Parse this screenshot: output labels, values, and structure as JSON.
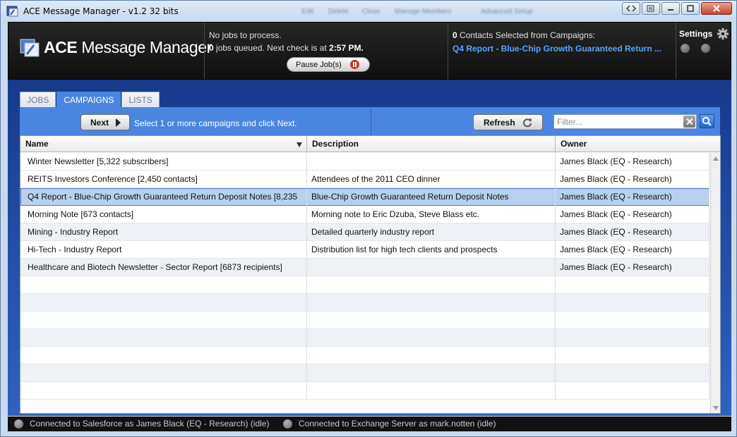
{
  "window": {
    "title": "ACE Message Manager - v1.2 32 bits",
    "obscured_menu": [
      "Edit",
      "Delete",
      "Close",
      "Manage Members",
      "Advanced Setup"
    ]
  },
  "header": {
    "logo_bold": "ACE",
    "logo_rest": " Message Manager",
    "status_line1": "No jobs to process.",
    "jobs_queued_count": "0",
    "status_line2": " jobs queued.  Next check is at ",
    "next_check_time": "2:57 PM.",
    "pause_label": "Pause Job(s)",
    "contacts_count": "0",
    "contacts_text": " Contacts Selected from Campaigns:",
    "selected_campaign_link": "Q4 Report - Blue-Chip Growth Guaranteed Return ...",
    "settings_label": "Settings"
  },
  "tabs": [
    {
      "label": "JOBS",
      "active": false
    },
    {
      "label": "CAMPAIGNS",
      "active": true
    },
    {
      "label": "LISTS",
      "active": false
    }
  ],
  "toolbar": {
    "next_label": "Next",
    "hint": "Select 1 or more campaigns and click Next.",
    "refresh_label": "Refresh",
    "filter_placeholder": "Filter..."
  },
  "grid": {
    "columns": [
      "Name",
      "Description",
      "Owner"
    ],
    "rows": [
      {
        "name": "Winter Newsletter [5,322 subscribers]",
        "description": "",
        "owner": "James Black (EQ - Research)"
      },
      {
        "name": "REITS Investors Conference [2,450 contacts]",
        "description": "Attendees of the 2011 CEO dinner",
        "owner": "James Black (EQ - Research)"
      },
      {
        "name": "Q4 Report - Blue-Chip Growth Guaranteed Return Deposit Notes  [8,235",
        "description": "Blue-Chip Growth Guaranteed Return Deposit Notes",
        "owner": "James Black (EQ - Research)",
        "selected": true
      },
      {
        "name": "Morning Note [673 contacts]",
        "description": "Morning note to Eric Dzuba, Steve Blass etc.",
        "owner": "James Black (EQ - Research)"
      },
      {
        "name": "Mining - Industry Report",
        "description": "Detailed quarterly industry report",
        "owner": "James Black (EQ - Research)"
      },
      {
        "name": "Hi-Tech - Industry Report",
        "description": "Distribution list for high tech clients and prospects",
        "owner": "James Black (EQ - Research)"
      },
      {
        "name": "Healthcare and Biotech Newsletter - Sector Report [6873 recipients]",
        "description": "",
        "owner": "James Black (EQ - Research)"
      }
    ]
  },
  "statusbar": {
    "salesforce": "Connected to Salesforce as James Black (EQ - Research) (idle)",
    "exchange": "Connected to Exchange Server as mark.notten (idle)"
  },
  "colors": {
    "accent": "#4a86e0",
    "link": "#5aa3ff",
    "selection": "#b8d0f0",
    "pause_red": "#c8342a"
  }
}
